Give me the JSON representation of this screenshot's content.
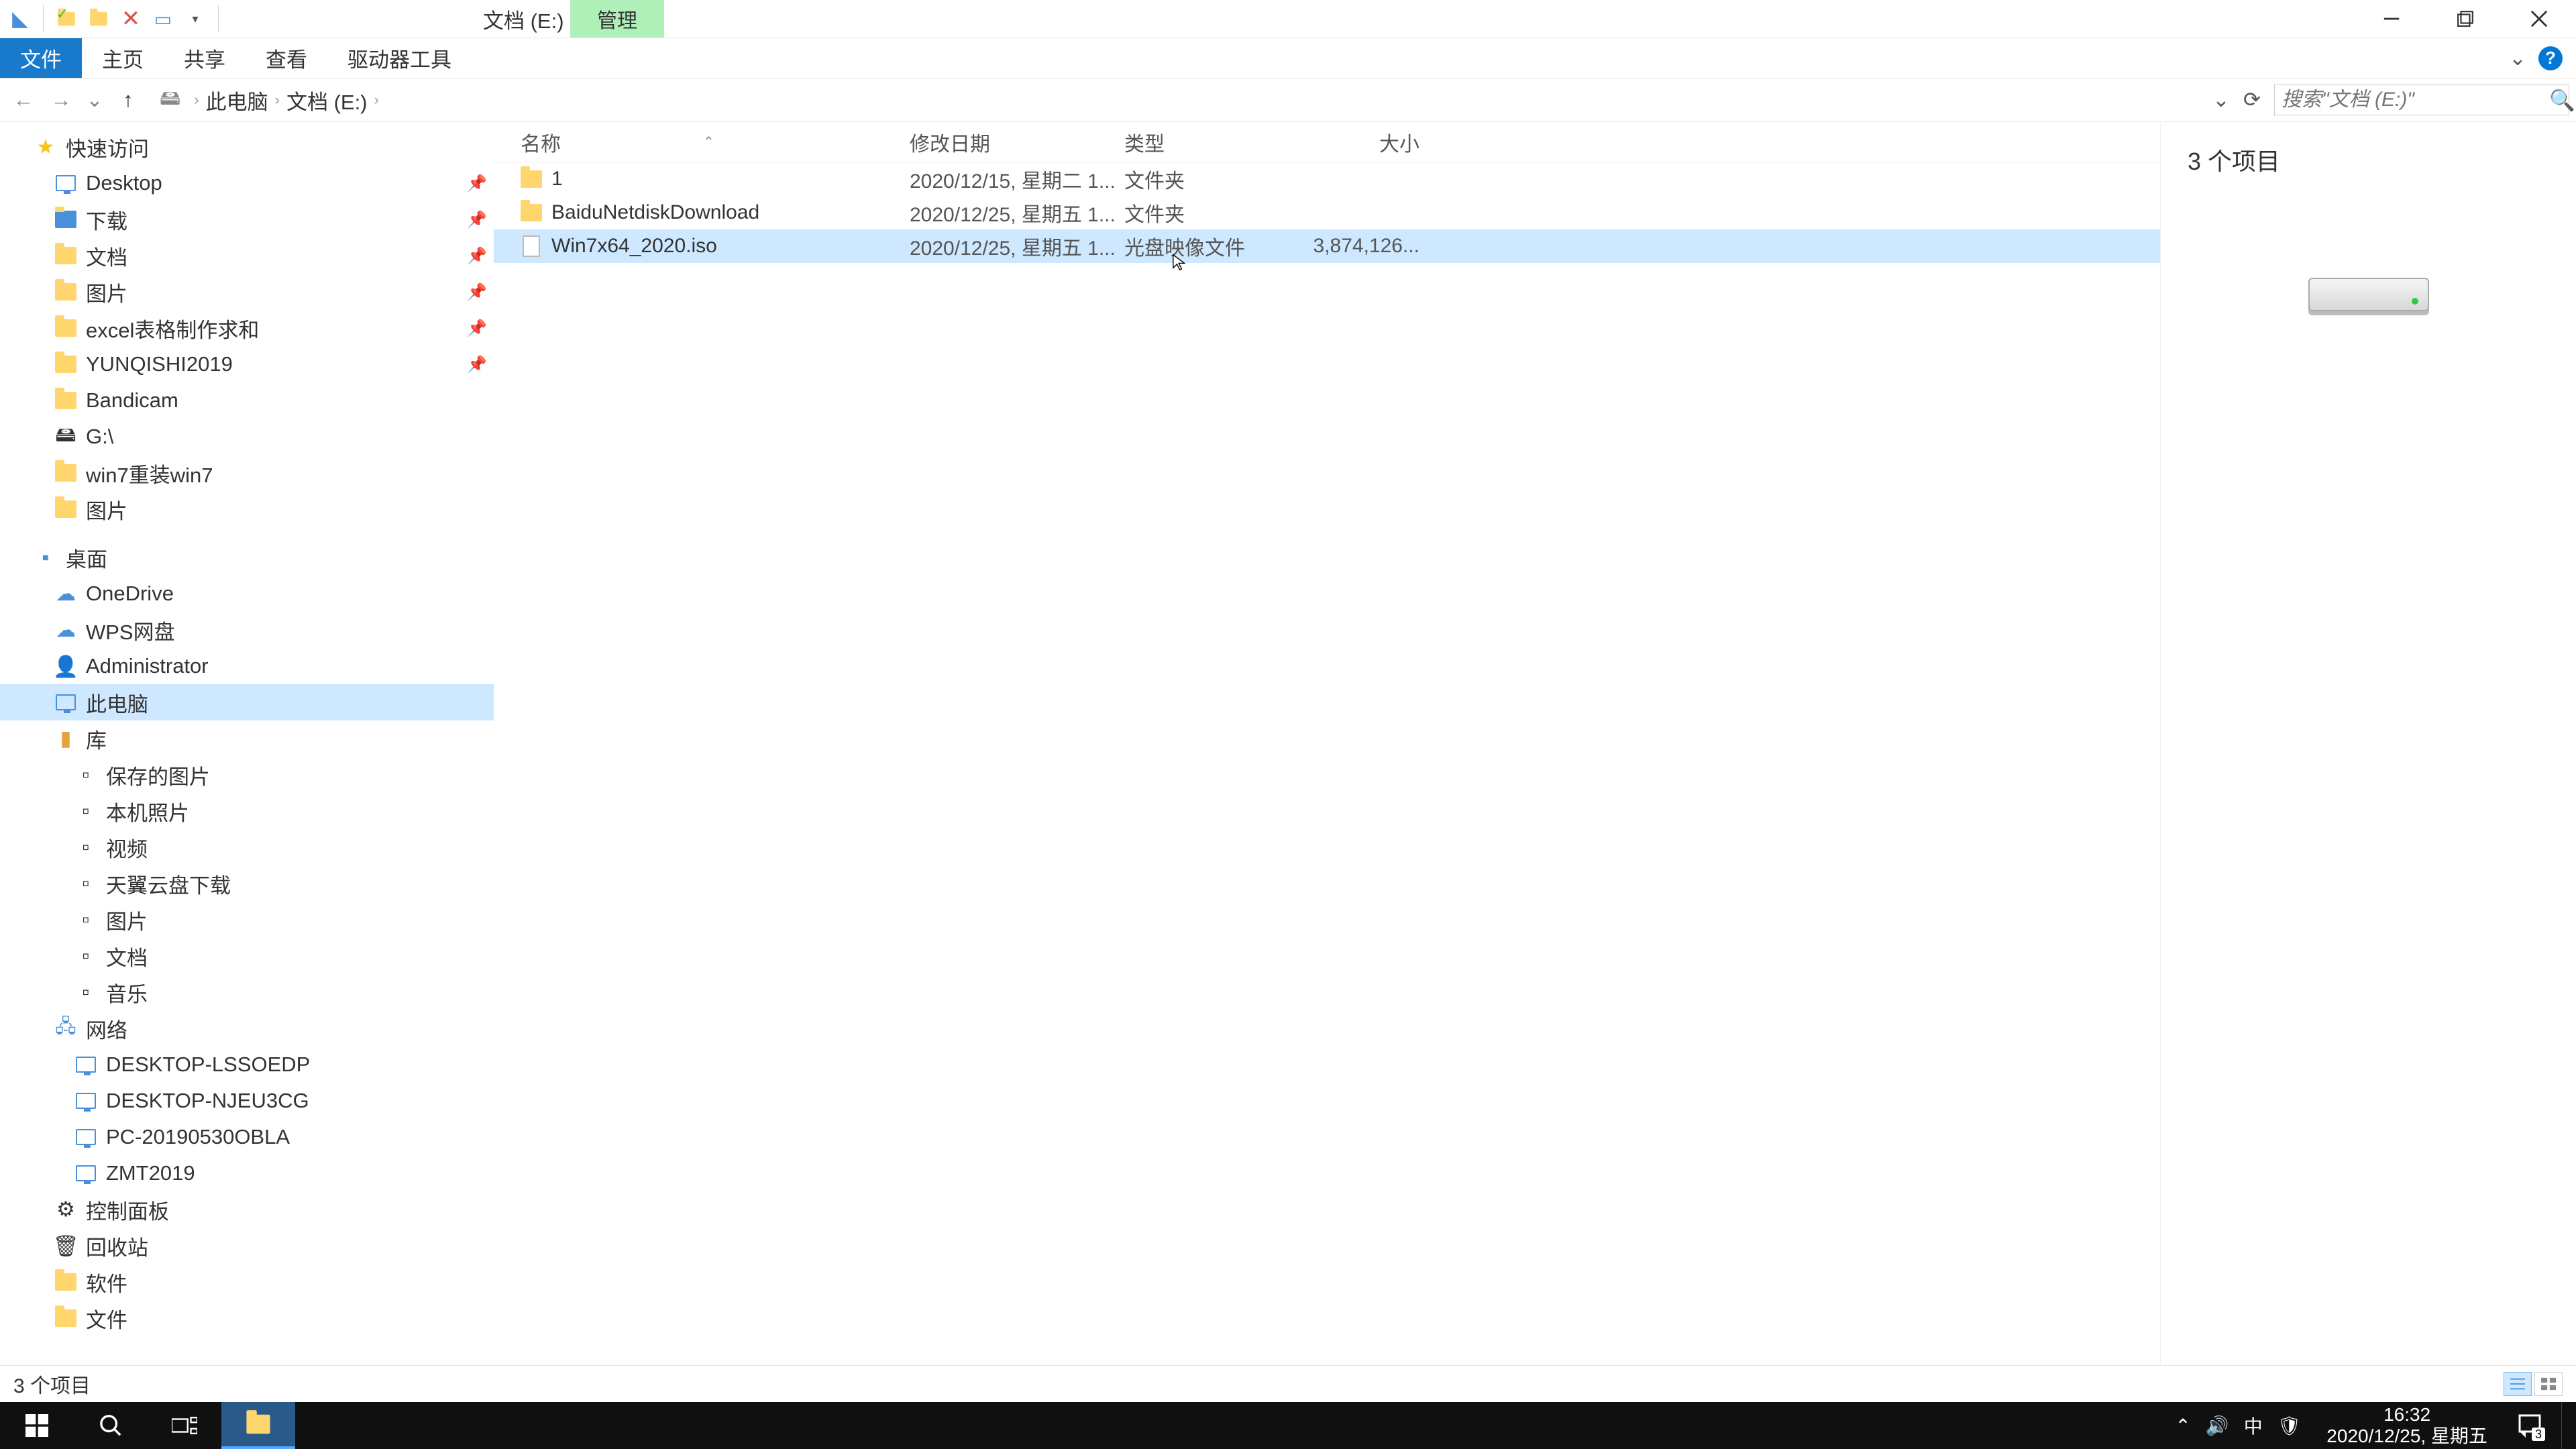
{
  "titlebar": {
    "context_tab": "管理",
    "title": "文档 (E:)"
  },
  "ribbon": {
    "tabs": [
      "文件",
      "主页",
      "共享",
      "查看",
      "驱动器工具"
    ],
    "active_index": 0
  },
  "addressbar": {
    "segments": [
      "此电脑",
      "文档 (E:)"
    ],
    "search_placeholder": "搜索\"文档 (E:)\""
  },
  "navpane": {
    "quick_access": {
      "label": "快速访问",
      "items": [
        {
          "label": "Desktop",
          "pinned": true,
          "icon": "monitor"
        },
        {
          "label": "下载",
          "pinned": true,
          "icon": "folder-blue"
        },
        {
          "label": "文档",
          "pinned": true,
          "icon": "folder"
        },
        {
          "label": "图片",
          "pinned": true,
          "icon": "folder"
        },
        {
          "label": "excel表格制作求和",
          "pinned": true,
          "icon": "folder"
        },
        {
          "label": "YUNQISHI2019",
          "pinned": true,
          "icon": "folder"
        },
        {
          "label": "Bandicam",
          "pinned": false,
          "icon": "folder"
        },
        {
          "label": "G:\\",
          "pinned": false,
          "icon": "drive"
        },
        {
          "label": "win7重装win7",
          "pinned": false,
          "icon": "folder"
        },
        {
          "label": "图片",
          "pinned": false,
          "icon": "folder"
        }
      ]
    },
    "desktop_section": {
      "label": "桌面",
      "items": [
        {
          "label": "OneDrive",
          "icon": "cloud"
        },
        {
          "label": "WPS网盘",
          "icon": "cloud"
        },
        {
          "label": "Administrator",
          "icon": "user"
        },
        {
          "label": "此电脑",
          "icon": "monitor",
          "selected": true
        },
        {
          "label": "库",
          "icon": "library"
        }
      ],
      "libraries": [
        {
          "label": "保存的图片"
        },
        {
          "label": "本机照片"
        },
        {
          "label": "视频"
        },
        {
          "label": "天翼云盘下载"
        },
        {
          "label": "图片"
        },
        {
          "label": "文档"
        },
        {
          "label": "音乐"
        }
      ],
      "network": {
        "label": "网络"
      },
      "network_items": [
        {
          "label": "DESKTOP-LSSOEDP"
        },
        {
          "label": "DESKTOP-NJEU3CG"
        },
        {
          "label": "PC-20190530OBLA"
        },
        {
          "label": "ZMT2019"
        }
      ],
      "tail": [
        {
          "label": "控制面板",
          "icon": "control"
        },
        {
          "label": "回收站",
          "icon": "recycle"
        },
        {
          "label": "软件",
          "icon": "folder"
        },
        {
          "label": "文件",
          "icon": "folder"
        }
      ]
    }
  },
  "filelist": {
    "columns": {
      "name": "名称",
      "date": "修改日期",
      "type": "类型",
      "size": "大小"
    },
    "rows": [
      {
        "name": "1",
        "date": "2020/12/15, 星期二 1...",
        "type": "文件夹",
        "size": "",
        "icon": "folder",
        "selected": false
      },
      {
        "name": "BaiduNetdiskDownload",
        "date": "2020/12/25, 星期五 1...",
        "type": "文件夹",
        "size": "",
        "icon": "folder",
        "selected": false
      },
      {
        "name": "Win7x64_2020.iso",
        "date": "2020/12/25, 星期五 1...",
        "type": "光盘映像文件",
        "size": "3,874,126...",
        "icon": "file",
        "selected": true
      }
    ]
  },
  "preview": {
    "title": "3 个项目"
  },
  "statusbar": {
    "text": "3 个项目"
  },
  "taskbar": {
    "time": "16:32",
    "date": "2020/12/25, 星期五",
    "ime": "中",
    "notif_count": "3"
  }
}
